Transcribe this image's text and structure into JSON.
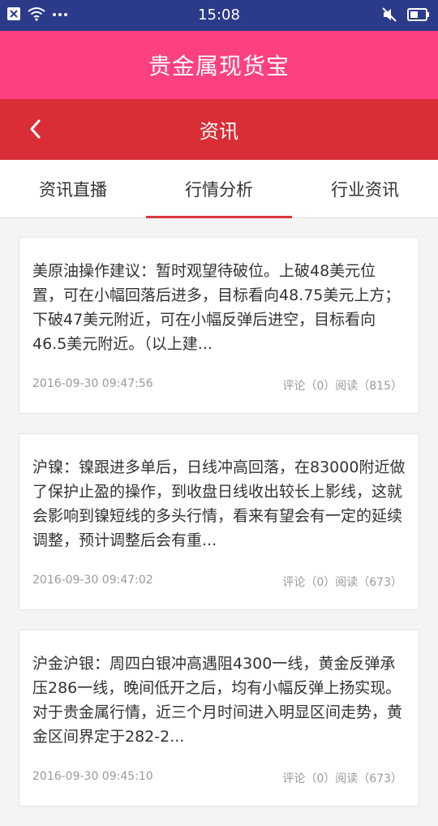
{
  "status_bar": {
    "time": "15:08",
    "icons": [
      "close-box-icon",
      "wifi-icon",
      "more-dots-icon",
      "mute-icon",
      "battery-icon"
    ]
  },
  "header": {
    "title": "贵金属现货宝"
  },
  "nav": {
    "title": "资讯",
    "back_icon": "chevron-left-icon"
  },
  "tabs": [
    {
      "label": "资讯直播",
      "active": false
    },
    {
      "label": "行情分析",
      "active": true
    },
    {
      "label": "行业资讯",
      "active": false
    }
  ],
  "articles": [
    {
      "text": "美原油操作建议：暂时观望待破位。上破48美元位置，可在小幅回落后进多，目标看向48.75美元上方；下破47美元附近，可在小幅反弹后进空，目标看向46.5美元附近。（以上建...",
      "date": "2016-09-30 09:47:56",
      "stats": "评论（0）阅读（815）"
    },
    {
      "text": "沪镍：镍跟进多单后，日线冲高回落，在83000附近做了保护止盈的操作，到收盘日线收出较长上影线，这就会影响到镍短线的多头行情，看来有望会有一定的延续调整，预计调整后会有重...",
      "date": "2016-09-30 09:47:02",
      "stats": "评论（0）阅读（673）"
    },
    {
      "text": "沪金沪银：周四白银冲高遇阻4300一线，黄金反弹承压286一线，晚间低开之后，均有小幅反弹上扬实现。对于贵金属行情，近三个月时间进入明显区间走势，黄金区间界定于282-2...",
      "date": "2016-09-30 09:45:10",
      "stats": "评论（0）阅读（673）"
    }
  ],
  "colors": {
    "status_bar": "#2c3a8a",
    "header": "#fd4080",
    "nav": "#da2e36",
    "tab_indicator": "#d9383e",
    "background": "#f4f4f4"
  }
}
